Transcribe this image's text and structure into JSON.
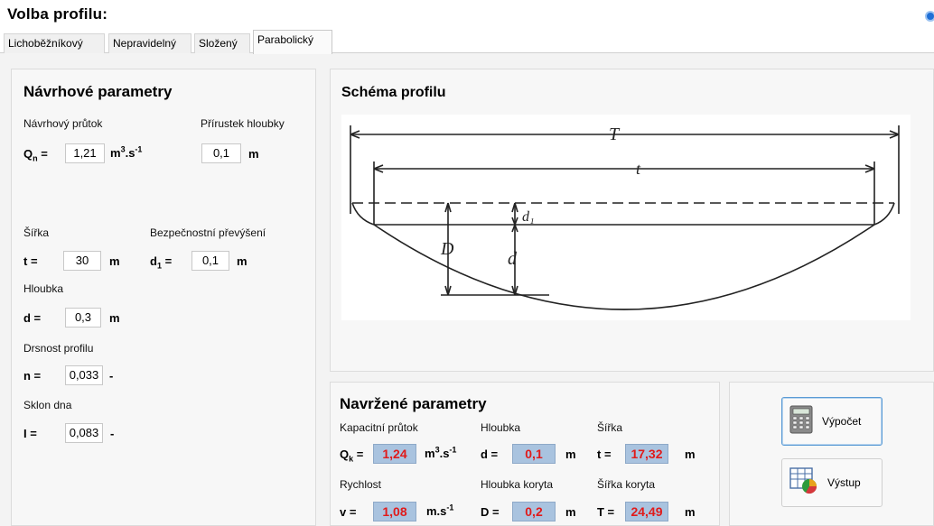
{
  "window_title": "Volba profilu:",
  "tabs": [
    {
      "label": "Lichoběžníkový"
    },
    {
      "label": "Nepravidelný"
    },
    {
      "label": "Složený"
    },
    {
      "label": "Parabolický"
    }
  ],
  "active_tab": "Parabolický",
  "design": {
    "heading": "Návrhové parametry",
    "flow_label": "Návrhový průtok",
    "flow_symbol": "Q",
    "flow_sub": "n",
    "flow_eq": " =",
    "flow_value": "1,21",
    "flow_unit": "m",
    "flow_unit_sup1": "3",
    "flow_unit_mid": ".s",
    "flow_unit_sup2": "-1",
    "depth_inc_label": "Přírustek hloubky",
    "depth_inc_value": "0,1",
    "depth_inc_unit": "m",
    "width_label": "Šířka",
    "width_symbol": "t =",
    "width_value": "30",
    "width_unit": "m",
    "freeboard_label": "Bezpečnostní převýšení",
    "freeboard_symbol": "d",
    "freeboard_sub": "1",
    "freeboard_eq": " =",
    "freeboard_value": "0,1",
    "freeboard_unit": "m",
    "depth_label": "Hloubka",
    "depth_symbol": "d  =",
    "depth_value": "0,3",
    "depth_unit": "m",
    "rough_label": "Drsnost profilu",
    "rough_symbol": "n  =",
    "rough_value": "0,033",
    "rough_unit": "-",
    "slope_label": "Sklon dna",
    "slope_symbol": "I =",
    "slope_value": "0,083",
    "slope_unit": "-"
  },
  "schema": {
    "heading": "Schéma profilu",
    "labels": {
      "T": "T",
      "t": "t",
      "d1": "d₁",
      "D": "D",
      "d": "d"
    }
  },
  "results": {
    "heading": "Navržené parametry",
    "cap_label": "Kapacitní průtok",
    "cap_symbol": "Q",
    "cap_sub": "k",
    "cap_eq": " =",
    "cap_value": "1,24",
    "cap_unit": "m",
    "cap_unit_sup1": "3",
    "cap_unit_mid": ".s",
    "cap_unit_sup2": "-1",
    "depth_label": "Hloubka",
    "depth_symbol": "d  =",
    "depth_value": "0,1",
    "depth_unit": "m",
    "width_label": "Šířka",
    "width_symbol": "t  =",
    "width_value": "17,32",
    "width_unit": "m",
    "speed_label": "Rychlost",
    "speed_symbol": "v  =",
    "speed_value": "1,08",
    "speed_unit": "m.s",
    "speed_unit_sup": "-1",
    "chdepth_label": "Hloubka koryta",
    "chdepth_symbol": "D  =",
    "chdepth_value": "0,2",
    "chdepth_unit": "m",
    "chwidth_label": "Šířka koryta",
    "chwidth_symbol": "T  =",
    "chwidth_value": "24,49",
    "chwidth_unit": "m"
  },
  "buttons": {
    "compute": "Výpočet",
    "output": "Výstup"
  },
  "icons": {
    "compute": "calculator-icon",
    "output": "report-chart-icon"
  }
}
